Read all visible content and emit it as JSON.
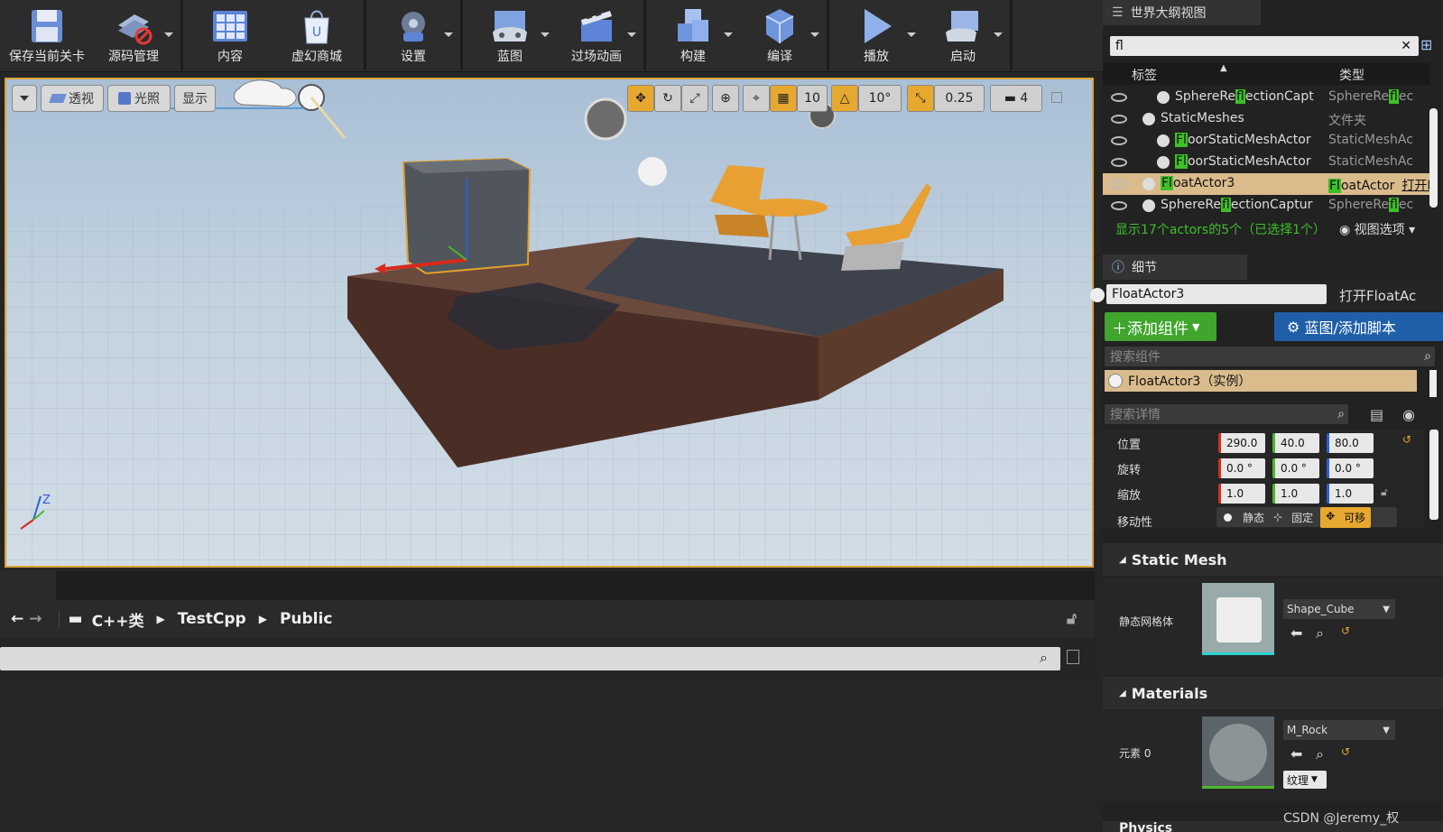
{
  "toolbar": {
    "buttons": [
      {
        "label": "保存当前关卡",
        "icon": "save-icon"
      },
      {
        "label": "源码管理",
        "icon": "source-control-icon"
      },
      {
        "label": "内容",
        "icon": "content-icon"
      },
      {
        "label": "虚幻商城",
        "icon": "marketplace-icon"
      },
      {
        "label": "设置",
        "icon": "settings-icon"
      },
      {
        "label": "蓝图",
        "icon": "blueprint-icon"
      },
      {
        "label": "过场动画",
        "icon": "cinematics-icon"
      },
      {
        "label": "构建",
        "icon": "build-icon"
      },
      {
        "label": "编译",
        "icon": "compile-icon"
      },
      {
        "label": "播放",
        "icon": "play-icon"
      },
      {
        "label": "启动",
        "icon": "launch-icon"
      }
    ]
  },
  "viewport": {
    "perspective_label": "透视",
    "lit_label": "光照",
    "show_label": "显示",
    "grid_snap": "10",
    "rotation_snap": "10°",
    "scale_snap": "0.25",
    "camera_speed": "4",
    "axis_z": "Z"
  },
  "content_browser": {
    "path": [
      "C++类",
      "TestCpp",
      "Public"
    ]
  },
  "outliner": {
    "title": "世界大纲视图",
    "search_value": "fl",
    "col_label": "标签",
    "col_type": "类型",
    "rows": [
      {
        "name_pre": "SphereRe",
        "name_hl": "fl",
        "name_post": "ectionCapt",
        "type_pre": "SphereRe",
        "type_hl": "fl",
        "type_post": "ec",
        "indent": 1,
        "icon": "reflection-capture-icon"
      },
      {
        "name_pre": "StaticMeshes",
        "name_hl": "",
        "name_post": "",
        "type_pre": "文件夹",
        "type_hl": "",
        "type_post": "",
        "indent": 0,
        "icon": "folder-icon"
      },
      {
        "name_pre": "",
        "name_hl": "Fl",
        "name_post": "oorStaticMeshActor",
        "type_pre": "StaticMeshAc",
        "type_hl": "",
        "type_post": "",
        "indent": 1,
        "icon": "static-mesh-actor-icon"
      },
      {
        "name_pre": "",
        "name_hl": "Fl",
        "name_post": "oorStaticMeshActor",
        "type_pre": "StaticMeshAc",
        "type_hl": "",
        "type_post": "",
        "indent": 1,
        "icon": "static-mesh-actor-icon"
      },
      {
        "name_pre": "",
        "name_hl": "Fl",
        "name_post": "oatActor3",
        "type_pre": "",
        "type_hl": "Fl",
        "type_post": "oatActor",
        "type_link": "打开FloatAc",
        "indent": 0,
        "icon": "sphere-actor-icon",
        "selected": true
      },
      {
        "name_pre": "SphereRe",
        "name_hl": "fl",
        "name_post": "ectionCaptur",
        "type_pre": "SphereRe",
        "type_hl": "fl",
        "type_post": "ec",
        "indent": 0,
        "icon": "reflection-capture-icon"
      }
    ],
    "status": "显示17个actors的5个（已选择1个）",
    "view_options": "视图选项"
  },
  "details": {
    "title": "细节",
    "actor_name": "FloatActor3",
    "open_link": "打开FloatAc",
    "add_component": "添加组件",
    "blueprint_button": "蓝图/添加脚本",
    "search_components_placeholder": "搜索组件",
    "component_instance": "FloatActor3（实例）",
    "search_details_placeholder": "搜索详情",
    "location_label": "位置",
    "location": [
      "290.0",
      "40.0",
      "80.0"
    ],
    "rotation_label": "旋转",
    "rotation": [
      "0.0 °",
      "0.0 °",
      "0.0 °"
    ],
    "scale_label": "缩放",
    "scale": [
      "1.0",
      "1.0",
      "1.0"
    ],
    "mobility_label": "移动性",
    "mobility_static": "静态",
    "mobility_stationary": "固定",
    "mobility_movable": "可移",
    "static_mesh_section": "Static Mesh",
    "static_mesh_label": "静态网格体",
    "static_mesh_value": "Shape_Cube",
    "materials_section": "Materials",
    "element_label": "元素 0",
    "material_value": "M_Rock",
    "texture_label": "纹理",
    "next_section": "Physics"
  },
  "watermark": "CSDN @Jeremy_权",
  "colors": {
    "accent": "#d9a435",
    "green": "#3fa52c",
    "blue": "#1f5fa8"
  }
}
